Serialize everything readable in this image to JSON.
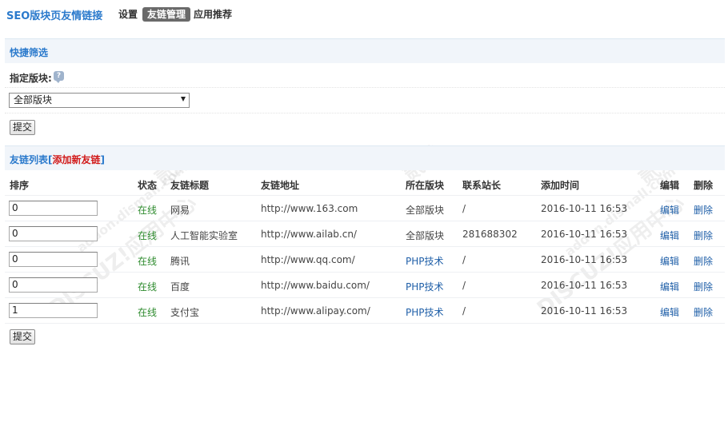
{
  "header": {
    "title": "SEO版块页友情链接",
    "nav": [
      {
        "label": "设置",
        "active": false
      },
      {
        "label": "友链管理",
        "active": true
      },
      {
        "label": "应用推荐",
        "active": false
      }
    ]
  },
  "filter": {
    "section_title": "快捷筛选",
    "label": "指定版块:",
    "help_icon": "help-bubble-icon",
    "select_value": "全部版块",
    "submit_label": "提交"
  },
  "list": {
    "section_title": "友链列表",
    "bracket_open": "[",
    "add_label": "添加新友链",
    "bracket_close": "]",
    "columns": [
      "排序",
      "状态",
      "友链标题",
      "友链地址",
      "所在版块",
      "联系站长",
      "添加时间",
      "编辑",
      "删除"
    ],
    "rows": [
      {
        "order": "0",
        "status": "在线",
        "title": "网易",
        "url": "http://www.163.com",
        "forum": "全部版块",
        "forum_link": false,
        "contact": "/",
        "time": "2016-10-11 16:53",
        "edit": "编辑",
        "delete": "删除"
      },
      {
        "order": "0",
        "status": "在线",
        "title": "人工智能实验室",
        "url": "http://www.ailab.cn/",
        "forum": "全部版块",
        "forum_link": false,
        "contact": "281688302",
        "time": "2016-10-11 16:53",
        "edit": "编辑",
        "delete": "删除"
      },
      {
        "order": "0",
        "status": "在线",
        "title": "腾讯",
        "url": "http://www.qq.com/",
        "forum": "PHP技术",
        "forum_link": true,
        "contact": "/",
        "time": "2016-10-11 16:53",
        "edit": "编辑",
        "delete": "删除"
      },
      {
        "order": "0",
        "status": "在线",
        "title": "百度",
        "url": "http://www.baidu.com/",
        "forum": "PHP技术",
        "forum_link": true,
        "contact": "/",
        "time": "2016-10-11 16:53",
        "edit": "编辑",
        "delete": "删除"
      },
      {
        "order": "1",
        "status": "在线",
        "title": "支付宝",
        "url": "http://www.alipay.com/",
        "forum": "PHP技术",
        "forum_link": true,
        "contact": "/",
        "time": "2016-10-11 16:53",
        "edit": "编辑",
        "delete": "删除"
      }
    ],
    "submit_label": "提交"
  },
  "watermarks": [
    "DISCUZ!应用中心",
    "addon.dismall.com",
    "贰道"
  ],
  "colors": {
    "accent": "#2b7acc",
    "online": "#2e8b2e",
    "link": "#1f5fa8",
    "add": "#d11a1a"
  }
}
